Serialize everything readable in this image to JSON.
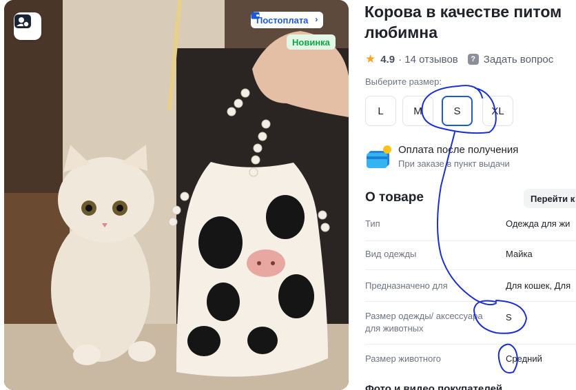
{
  "product": {
    "title_line1": "Корова в качестве питом",
    "title_line2": "любимна",
    "rating": "4.9",
    "reviews": "· 14 отзывов",
    "ask_question": "Задать вопрос"
  },
  "gallery": {
    "postpay_badge": "Постоплата",
    "new_badge": "Новинка"
  },
  "sizes": {
    "label": "Выберите размер:",
    "options": [
      "L",
      "M",
      "S",
      "XL"
    ],
    "selected": "S"
  },
  "payment": {
    "title": "Оплата после получения",
    "subtitle": "При заказе в пункт выдачи"
  },
  "about": {
    "title": "О товаре",
    "goto_button": "Перейти к",
    "specs": [
      {
        "key": "Тип",
        "value": "Одежда для жи"
      },
      {
        "key": "Вид одежды",
        "value": "Майка"
      },
      {
        "key": "Предназначено для",
        "value": "Для кошек, Для"
      },
      {
        "key": "Размер одежды/ аксессуара для животных",
        "value": "S"
      },
      {
        "key": "Размер животного",
        "value": "Средний"
      }
    ]
  },
  "photos_section_title": "Фото и видео покупателей",
  "colors": {
    "accent": "#1c59d6",
    "new_badge_text": "#12a348",
    "star": "#f5a623",
    "annotation_ink": "#1a2fd0"
  }
}
